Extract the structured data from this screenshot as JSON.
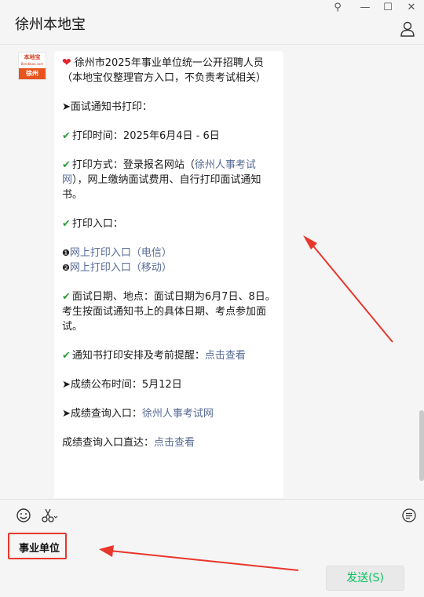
{
  "window": {
    "title": "徐州本地宝",
    "controls": {
      "pin": "⚲",
      "minimize": "—",
      "maximize": "☐",
      "close": "✕"
    }
  },
  "avatar": {
    "brand_top": "本地宝",
    "brand_sub": "Bendibao.com",
    "brand_city": "徐州"
  },
  "message": {
    "line_title": "徐州市2025年事业单位统一公开招聘人员",
    "line_note": "（本地宝仅整理官方入口，不负责考试相关）",
    "section_interview_print": "➤面试通知书打印：",
    "print_time_label": "打印时间：",
    "print_time_value": "2025年6月4日 - 6日",
    "print_method_label": "打印方式：登录报名网站（",
    "print_method_link": "徐州人事考试网",
    "print_method_tail": "），网上缴纳面试费用、自行打印面试通知书。",
    "print_entry_label": "打印入口：",
    "entry_1_bullet": "❶",
    "entry_1_link": "网上打印入口（电信）",
    "entry_2_bullet": "❷",
    "entry_2_link": "网上打印入口（移动）",
    "interview_info": "面试日期、地点：面试日期为6月7日、8日。考生按面试通知书上的具体日期、考点参加面试。",
    "notice_label": "通知书打印安排及考前提醒：",
    "notice_link": "点击查看",
    "score_time": "➤成绩公布时间：5月12日",
    "score_entry_label": "➤成绩查询入口：",
    "score_entry_link": "徐州人事考试网",
    "score_direct_label": "成绩查询入口直达：",
    "score_direct_link": "点击查看"
  },
  "input": {
    "value": "事业单位"
  },
  "send_button": {
    "label": "发送(S)"
  },
  "colors": {
    "accent_red": "#e8362b",
    "link": "#576b95",
    "send_green": "#07c160"
  }
}
